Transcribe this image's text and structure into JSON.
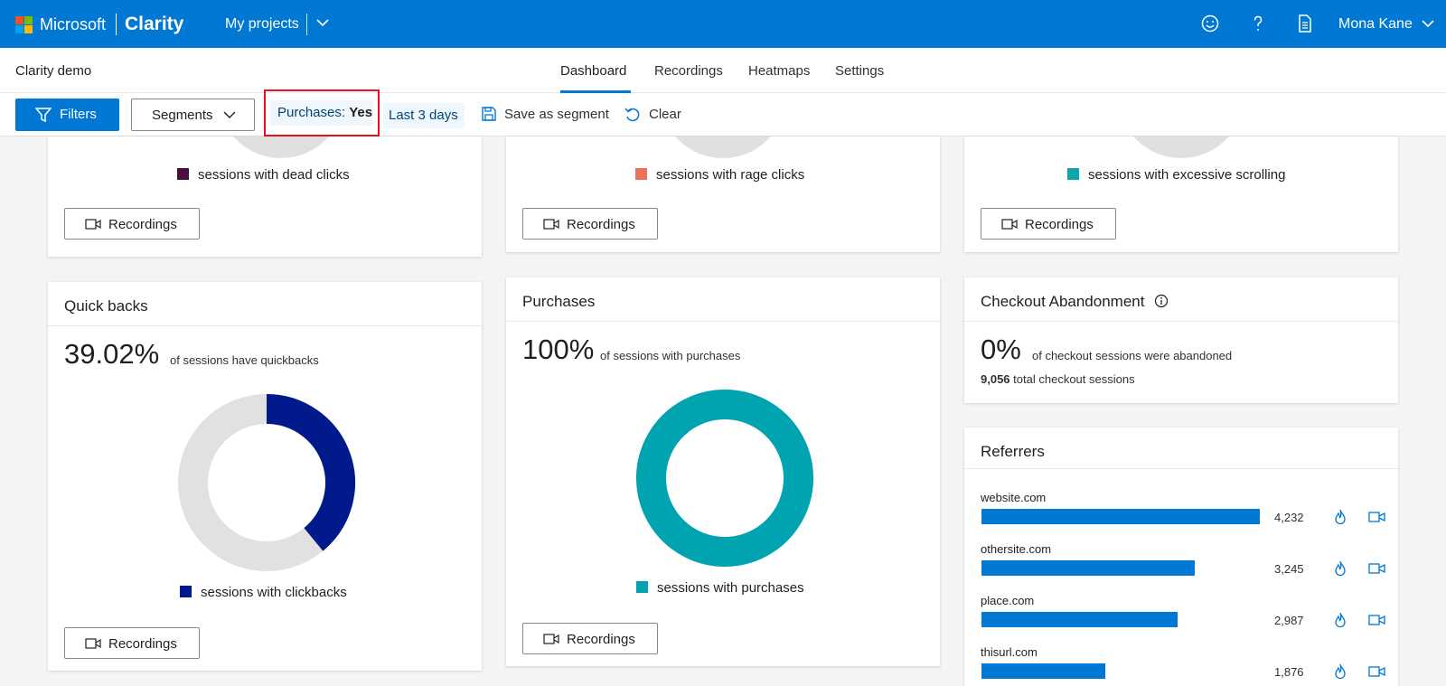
{
  "topbar": {
    "brand_company": "Microsoft",
    "brand_product": "Clarity",
    "projects_label": "My projects",
    "icons": [
      "smiley-icon",
      "help-icon",
      "document-icon"
    ],
    "user_name": "Mona Kane"
  },
  "subheader": {
    "project_title": "Clarity demo",
    "tabs": [
      {
        "label": "Dashboard",
        "active": true
      },
      {
        "label": "Recordings",
        "active": false
      },
      {
        "label": "Heatmaps",
        "active": false
      },
      {
        "label": "Settings",
        "active": false
      }
    ]
  },
  "filterbar": {
    "filters_label": "Filters",
    "segments_label": "Segments",
    "chip_purchases_key": "Purchases:",
    "chip_purchases_value": "Yes",
    "chip_days": "Last 3 days",
    "save_segment": "Save as segment",
    "clear": "Clear"
  },
  "colors": {
    "accent": "#0078d4",
    "dead_clicks": "#4b0f3f",
    "rage_clicks": "#e8735a",
    "excessive_scrolling": "#10a5ab",
    "clickbacks": "#001a8c",
    "purchases": "#00a4b0",
    "highlight_border": "#e81123"
  },
  "top_cards": [
    {
      "legend": "sessions with dead clicks",
      "recordings": "Recordings"
    },
    {
      "legend": "sessions with rage clicks",
      "recordings": "Recordings"
    },
    {
      "legend": "sessions with excessive scrolling",
      "recordings": "Recordings"
    }
  ],
  "quick_backs": {
    "title": "Quick backs",
    "value": "39.02%",
    "description": "of sessions have quickbacks",
    "fraction": 0.3902,
    "legend": "sessions with clickbacks",
    "recordings": "Recordings"
  },
  "purchases": {
    "title": "Purchases",
    "value": "100%",
    "description": "of sessions with purchases",
    "fraction": 1.0,
    "legend": "sessions with purchases",
    "recordings": "Recordings"
  },
  "checkout": {
    "title": "Checkout Abandonment",
    "value": "0%",
    "description": "of checkout sessions were abandoned",
    "total_number": "9,056",
    "total_label": "total checkout sessions"
  },
  "referrers": {
    "title": "Referrers",
    "max": 4232,
    "items": [
      {
        "name": "website.com",
        "value": 4232,
        "display": "4,232"
      },
      {
        "name": "othersite.com",
        "value": 3245,
        "display": "3,245"
      },
      {
        "name": "place.com",
        "value": 2987,
        "display": "2,987"
      },
      {
        "name": "thisurl.com",
        "value": 1876,
        "display": "1,876"
      }
    ]
  }
}
